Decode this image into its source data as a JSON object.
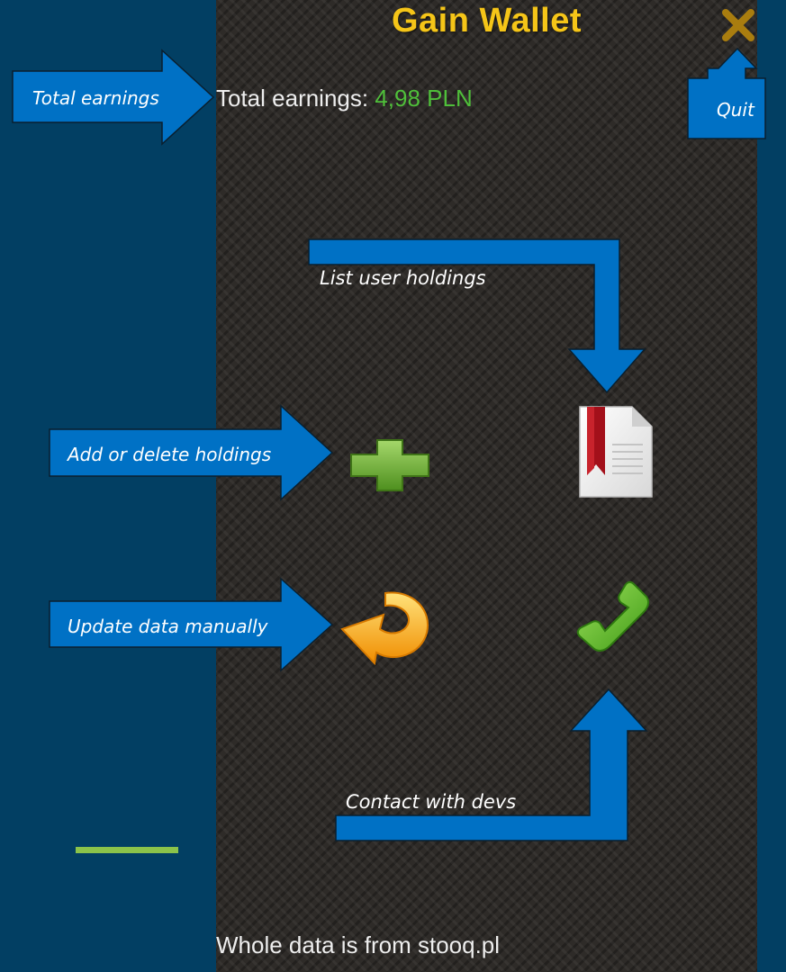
{
  "app": {
    "title": "Gain Wallet",
    "earnings_label": "Total earnings:",
    "earnings_value": "4,98 PLN",
    "footer": "Whole data is from stooq.pl"
  },
  "icons": {
    "quit": "close-icon",
    "holdings": "document-bookmark-icon",
    "add": "plus-icon",
    "update": "refresh-arrow-icon",
    "contact": "phone-icon"
  },
  "annotations": {
    "total_earnings": "Total earnings",
    "quit": "Quit",
    "list_holdings": "List user holdings",
    "add_delete": "Add or delete holdings",
    "update_data": "Update data manually",
    "contact": "Contact with devs"
  },
  "colors": {
    "background": "#023f63",
    "panel": "#2e2b28",
    "title": "#f5c518",
    "earnings_value": "#4fbf3a",
    "callout_fill": "#0071c5",
    "accent_bar": "#8bc34a"
  }
}
